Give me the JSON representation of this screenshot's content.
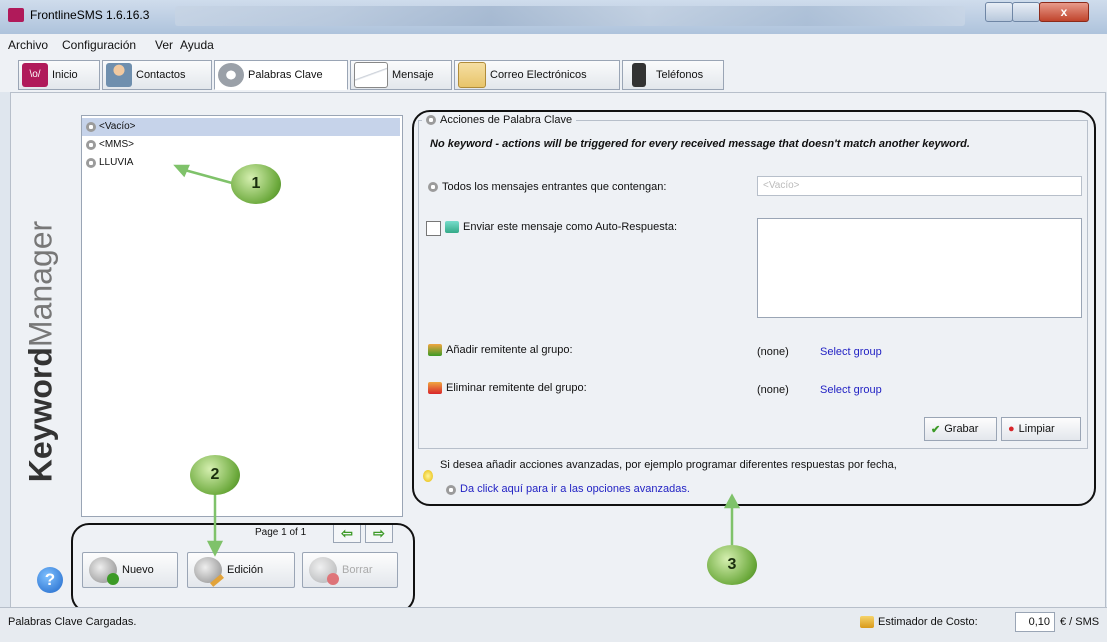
{
  "window": {
    "title": "FrontlineSMS 1.6.16.3",
    "close_glyph": "x"
  },
  "menu": [
    "Archivo",
    "Configuración",
    "Ver",
    "Ayuda"
  ],
  "tabs": [
    {
      "label": "Inicio",
      "icon": "frontline-logo-icon",
      "color": "#b01a5a"
    },
    {
      "label": "Contactos",
      "icon": "contacts-icon",
      "color": "#6f8fae"
    },
    {
      "label": "Palabras Clave",
      "icon": "gear-icon",
      "color": "#9aa0a8"
    },
    {
      "label": "Mensaje",
      "icon": "envelope-icon",
      "color": "#d9dde3"
    },
    {
      "label": "Correo Electrónicos",
      "icon": "email-icon",
      "color": "#e8c46a"
    },
    {
      "label": "Teléfonos",
      "icon": "phone-icon",
      "color": "#333333"
    }
  ],
  "active_tab": "Palabras Clave",
  "sidebar": {
    "title_bold": "Keyword",
    "title_light": "Manager"
  },
  "keywords": [
    {
      "label": "<Vacío>",
      "selected": true
    },
    {
      "label": "<MMS>",
      "selected": false
    },
    {
      "label": "LLUVIA",
      "selected": false
    }
  ],
  "pager": {
    "text": "Page 1 of 1",
    "prev": "⇦",
    "next": "⇨"
  },
  "buttons": {
    "new": "Nuevo",
    "edit": "Edición",
    "delete": "Borrar"
  },
  "help_glyph": "?",
  "actions": {
    "legend": "Acciones de Palabra Clave",
    "notice": "No keyword - actions will be triggered for every received message that doesn't match another keyword.",
    "all_messages_label": "Todos los mensajes entrantes que contengan:",
    "keyword_value": "<Vacío>",
    "auto_reply_label": "Enviar este mensaje como Auto-Respuesta:",
    "add_group_label": "Añadir remitente al grupo:",
    "add_group_value": "(none)",
    "remove_group_label": "Eliminar remitente del grupo:",
    "remove_group_value": "(none)",
    "select_group": "Select group",
    "save": "Grabar",
    "clear": "Limpiar",
    "save_icon_color": "#3c9a26",
    "clear_icon_color": "#d8252a"
  },
  "advanced": {
    "hint": "Si desea añadir acciones avanzadas, por ejemplo programar diferentes respuestas por fecha,",
    "link": "Da click aquí para ir a las opciones avanzadas."
  },
  "annotations": [
    "1",
    "2",
    "3"
  ],
  "status": {
    "left": "Palabras Clave Cargadas.",
    "estimator": "Estimador de Costo:",
    "cost": "0,10",
    "unit": "€ / SMS"
  }
}
